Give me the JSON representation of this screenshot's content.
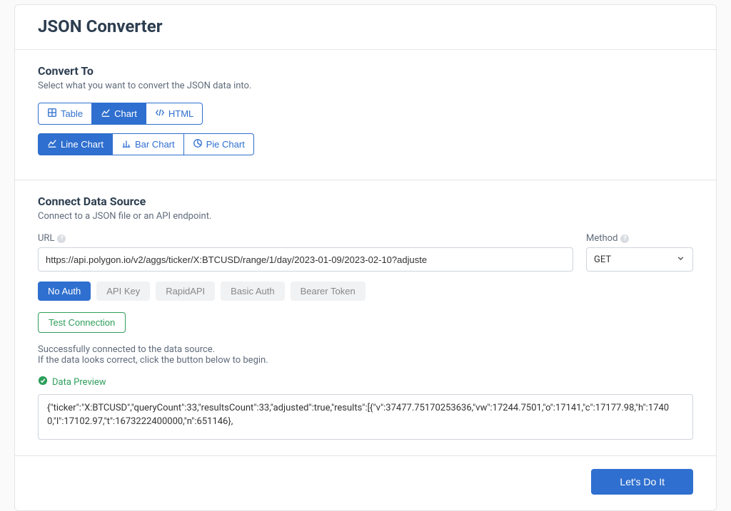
{
  "header": {
    "title": "JSON Converter"
  },
  "convert": {
    "heading": "Convert To",
    "desc": "Select what you want to convert the JSON data into.",
    "types": {
      "table": "Table",
      "chart": "Chart",
      "html": "HTML"
    },
    "chart_types": {
      "line": "Line Chart",
      "bar": "Bar Chart",
      "pie": "Pie Chart"
    }
  },
  "connect": {
    "heading": "Connect Data Source",
    "desc": "Connect to a JSON file or an API endpoint.",
    "url_label": "URL",
    "url_value": "https://api.polygon.io/v2/aggs/ticker/X:BTCUSD/range/1/day/2023-01-09/2023-02-10?adjuste",
    "method_label": "Method",
    "method_value": "GET",
    "auth": {
      "no_auth": "No Auth",
      "api_key": "API Key",
      "rapidapi": "RapidAPI",
      "basic": "Basic Auth",
      "bearer": "Bearer Token"
    },
    "test_btn": "Test Connection",
    "status1": "Successfully connected to the data source.",
    "status2": "If the data looks correct, click the button below to begin.",
    "preview_label": "Data Preview",
    "preview_text": "{\"ticker\":\"X:BTCUSD\",\"queryCount\":33,\"resultsCount\":33,\"adjusted\":true,\"results\":[{\"v\":37477.75170253636,\"vw\":17244.7501,\"o\":17141,\"c\":17177.98,\"h\":17400,\"l\":17102.97,\"t\":1673222400000,\"n\":651146},"
  },
  "footer": {
    "submit": "Let's Do It"
  }
}
